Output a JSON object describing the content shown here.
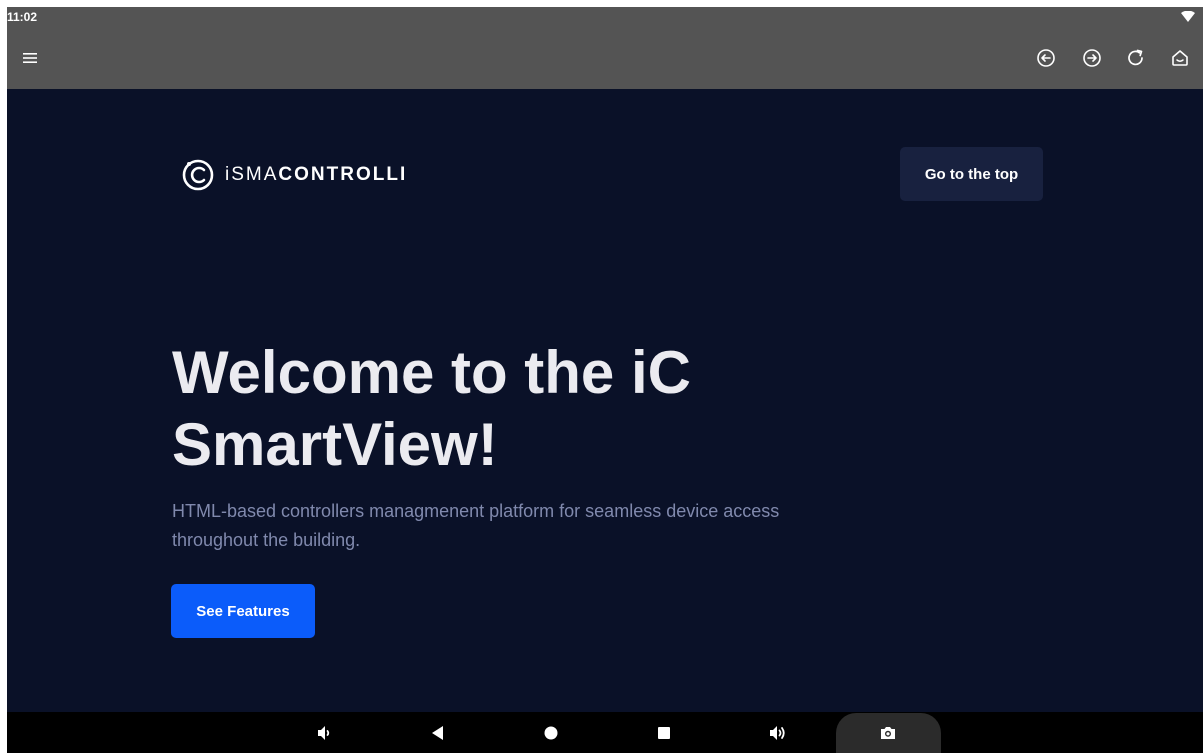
{
  "status_bar": {
    "time": "11:02",
    "wifi_icon": "wifi-icon"
  },
  "toolbar": {
    "icons": [
      "menu-icon",
      "back-arrow-icon",
      "forward-arrow-icon",
      "reload-icon",
      "home-icon"
    ]
  },
  "page": {
    "logo": {
      "prefix": "iSMA",
      "suffix": "CONTROLLI",
      "icon": "ismacontrolli-logo-icon"
    },
    "top_button_label": "Go to the top",
    "hero": {
      "title": "Welcome to the iC SmartView!",
      "subtitle": "HTML-based controllers managmenent platform for seamless device access throughout the building.",
      "cta_label": "See Features"
    }
  },
  "nav_bar": {
    "icons": [
      "volume-down-icon",
      "back-triangle-icon",
      "home-circle-icon",
      "recents-square-icon",
      "volume-up-icon",
      "camera-icon"
    ]
  },
  "colors": {
    "page_background": "#0a1128",
    "chrome_gray": "#545454",
    "primary_blue": "#0b5cfa",
    "secondary_button": "#18213f",
    "subtitle_text": "#8089ad"
  }
}
